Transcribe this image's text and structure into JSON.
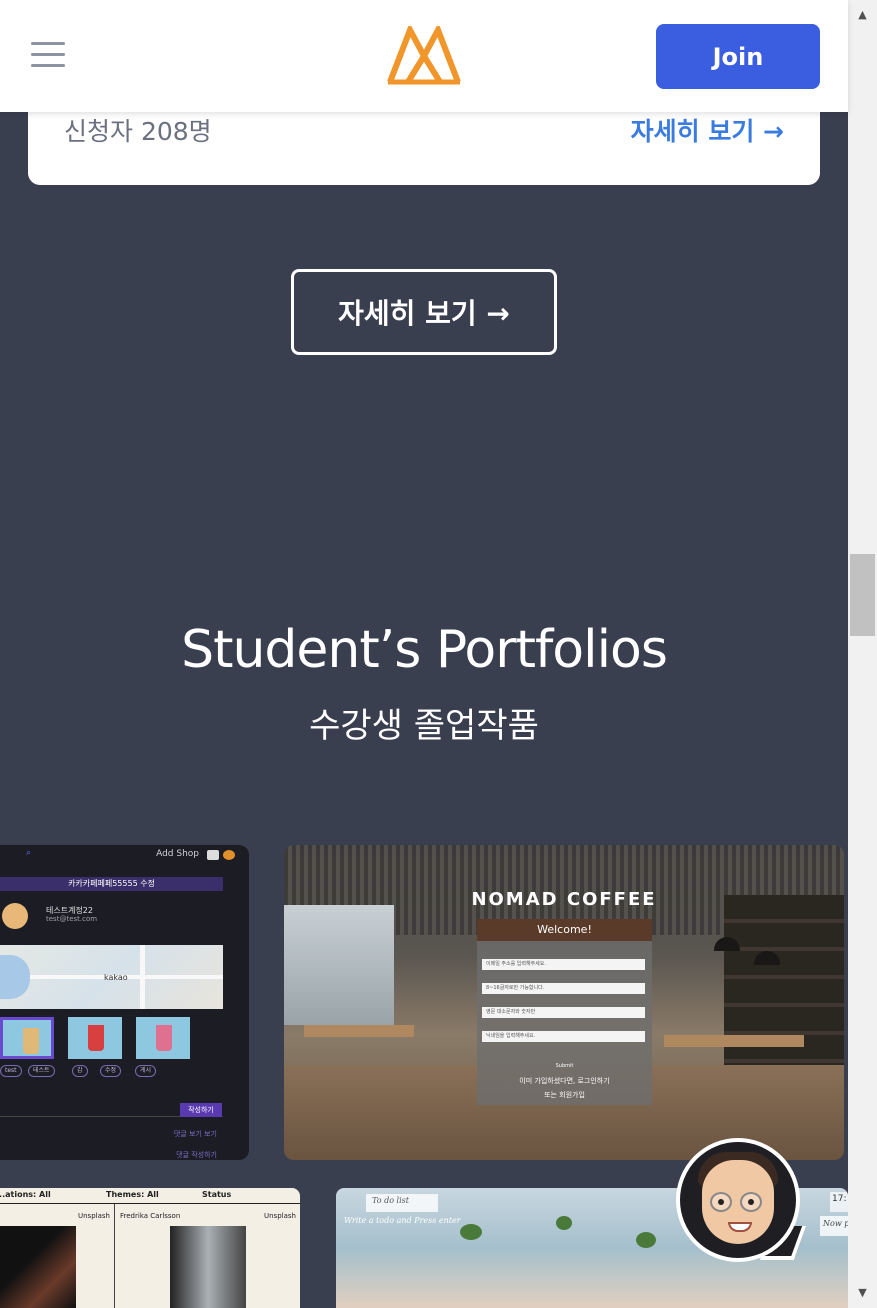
{
  "header": {
    "menu_icon": "hamburger-menu-icon",
    "logo_icon": "mountain-logo-icon",
    "logo_color": "#f0962a",
    "join_label": "Join",
    "join_color": "#3b5de0"
  },
  "course_card": {
    "applicants": "신청자 208명",
    "detail_link": "자세히 보기 →",
    "link_color": "#3a7be0"
  },
  "more_button": {
    "label": "자세히 보기 →"
  },
  "portfolios": {
    "title": "Student’s Portfolios",
    "subtitle": "수강생 졸업작품",
    "background_color": "#3a3f50",
    "items": [
      {
        "kind": "kakao-shop-app",
        "add_shop": "Add Shop",
        "header": "카카카페페페55555 수정",
        "user_name": "테스트계정22",
        "user_email": "test@test.com",
        "map_label": "kakao",
        "tags": [
          "test",
          "테스트",
          "갑",
          "수정",
          "게시"
        ],
        "write_button": "작성하기",
        "link1": "댓글 보기 보기",
        "link2": "댓글 작성하기"
      },
      {
        "kind": "nomad-coffee-app",
        "brand": "NOMAD COFFEE",
        "form_title": "Welcome!",
        "fields": [
          "이메일 주소를 입력해주세요.",
          "8~16글자로만 가능합니다.",
          "영문 대소문자와 숫자만",
          "닉네임을 입력해주세요."
        ],
        "submit": "Submit",
        "notice": "이미 가입하셨다면, 로그인하기",
        "notice2": "또는 회원가입"
      },
      {
        "kind": "photo-gallery-app",
        "filters": [
          "...ations: All",
          "Themes: All",
          "Status"
        ],
        "credits": [
          "Unsplash",
          "Fredrika Carlsson",
          "Unsplash"
        ]
      },
      {
        "kind": "todo-app",
        "todo_title": "To do list",
        "placeholder": "Write a todo and Press enter",
        "clock": "17:",
        "note": "Now p"
      }
    ]
  },
  "chat": {
    "avatar_icon": "memoji-avatar-icon"
  },
  "scrollbar": {
    "up_icon": "▲",
    "down_icon": "▼"
  }
}
